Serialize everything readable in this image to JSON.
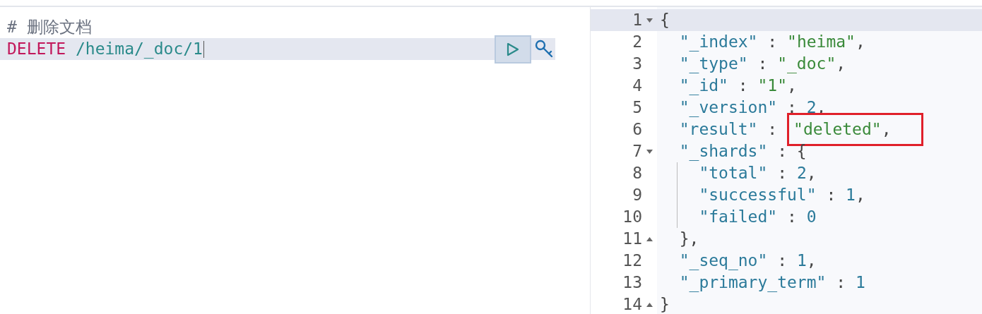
{
  "request_editor": {
    "lines": [
      {
        "current": false,
        "tokens": [
          {
            "kind": "comment",
            "text": "# 删除文档"
          }
        ]
      },
      {
        "current": true,
        "tokens": [
          {
            "kind": "method",
            "text": "DELETE"
          },
          {
            "kind": "url",
            "text": " /heima/_doc/1"
          }
        ]
      }
    ]
  },
  "response_viewer": {
    "lines": [
      {
        "number": "1",
        "kind": "open",
        "current": true,
        "tokens": [
          {
            "kind": "punct",
            "text": "{"
          }
        ]
      },
      {
        "number": "2",
        "current": false,
        "tokens": [
          {
            "kind": "key",
            "text": "  \"_index\""
          },
          {
            "kind": "punct",
            "text": " : "
          },
          {
            "kind": "string",
            "text": "\"heima\""
          },
          {
            "kind": "punct",
            "text": ","
          }
        ]
      },
      {
        "number": "3",
        "current": false,
        "tokens": [
          {
            "kind": "key",
            "text": "  \"_type\""
          },
          {
            "kind": "punct",
            "text": " : "
          },
          {
            "kind": "string",
            "text": "\"_doc\""
          },
          {
            "kind": "punct",
            "text": ","
          }
        ]
      },
      {
        "number": "4",
        "current": false,
        "tokens": [
          {
            "kind": "key",
            "text": "  \"_id\""
          },
          {
            "kind": "punct",
            "text": " : "
          },
          {
            "kind": "string",
            "text": "\"1\""
          },
          {
            "kind": "punct",
            "text": ","
          }
        ]
      },
      {
        "number": "5",
        "current": false,
        "tokens": [
          {
            "kind": "key",
            "text": "  \"_version\""
          },
          {
            "kind": "punct",
            "text": " : "
          },
          {
            "kind": "number",
            "text": "2"
          },
          {
            "kind": "punct",
            "text": ","
          }
        ]
      },
      {
        "number": "6",
        "current": false,
        "tokens": [
          {
            "kind": "key",
            "text": "  \"result\""
          },
          {
            "kind": "punct",
            "text": " : "
          },
          {
            "kind": "string",
            "text": "\"deleted\"",
            "highlighted": true
          },
          {
            "kind": "punct",
            "text": ",",
            "highlighted": true
          }
        ]
      },
      {
        "number": "7",
        "kind": "open",
        "current": false,
        "tokens": [
          {
            "kind": "key",
            "text": "  \"_shards\""
          },
          {
            "kind": "punct",
            "text": " : {"
          }
        ]
      },
      {
        "number": "8",
        "current": false,
        "guide": true,
        "tokens": [
          {
            "kind": "key",
            "text": "    \"total\""
          },
          {
            "kind": "punct",
            "text": " : "
          },
          {
            "kind": "number",
            "text": "2"
          },
          {
            "kind": "punct",
            "text": ","
          }
        ]
      },
      {
        "number": "9",
        "current": false,
        "guide": true,
        "tokens": [
          {
            "kind": "key",
            "text": "    \"successful\""
          },
          {
            "kind": "punct",
            "text": " : "
          },
          {
            "kind": "number",
            "text": "1"
          },
          {
            "kind": "punct",
            "text": ","
          }
        ]
      },
      {
        "number": "10",
        "current": false,
        "guide": true,
        "tokens": [
          {
            "kind": "key",
            "text": "    \"failed\""
          },
          {
            "kind": "punct",
            "text": " : "
          },
          {
            "kind": "number",
            "text": "0"
          }
        ]
      },
      {
        "number": "11",
        "kind": "close",
        "current": false,
        "tokens": [
          {
            "kind": "punct",
            "text": "  },"
          }
        ]
      },
      {
        "number": "12",
        "current": false,
        "tokens": [
          {
            "kind": "key",
            "text": "  \"_seq_no\""
          },
          {
            "kind": "punct",
            "text": " : "
          },
          {
            "kind": "number",
            "text": "1"
          },
          {
            "kind": "punct",
            "text": ","
          }
        ]
      },
      {
        "number": "13",
        "current": false,
        "tokens": [
          {
            "kind": "key",
            "text": "  \"_primary_term\""
          },
          {
            "kind": "punct",
            "text": " : "
          },
          {
            "kind": "number",
            "text": "1"
          }
        ]
      },
      {
        "number": "14",
        "kind": "close",
        "current": false,
        "tokens": [
          {
            "kind": "punct",
            "text": "}"
          }
        ]
      }
    ]
  }
}
